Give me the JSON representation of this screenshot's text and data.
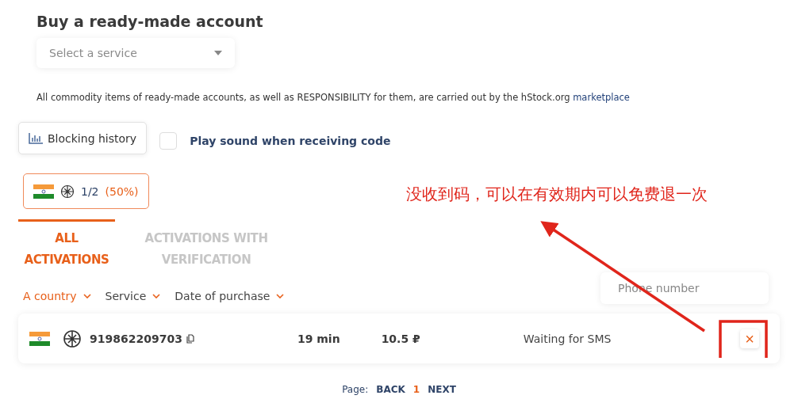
{
  "title": "Buy a ready-made account",
  "service_select": {
    "placeholder": "Select a service"
  },
  "notice": {
    "text": "All commodity items of ready-made accounts, as well as RESPONSIBILITY for them, are carried out by the hStock.org",
    "link": "marketplace"
  },
  "blocking_history_button": "Blocking history",
  "sound_option": {
    "label": "Play sound when receiving code",
    "checked": false
  },
  "stat_chip": {
    "count": "1/2",
    "percent": "(50%)"
  },
  "tabs": [
    {
      "label": "ALL ACTIVATIONS",
      "selected": true
    },
    {
      "label": "ACTIVATIONS WITH VERIFICATION",
      "selected": false
    }
  ],
  "filters": [
    {
      "label": "A country",
      "active": true
    },
    {
      "label": "Service",
      "active": false
    },
    {
      "label": "Date of purchase",
      "active": false
    }
  ],
  "phone_search": {
    "placeholder": "Phone number"
  },
  "activations": [
    {
      "phone": "919862209703",
      "time": "19 min",
      "price": "10.5 ₽",
      "status": "Waiting for SMS",
      "cancel": "×"
    }
  ],
  "pagination": {
    "label": "Page:",
    "back": "BACK",
    "pages": [
      {
        "label": "1",
        "selected": true
      }
    ],
    "next": "NEXT"
  },
  "annotation": {
    "text": "没收到码，可以在有效期内可以免费退一次"
  }
}
